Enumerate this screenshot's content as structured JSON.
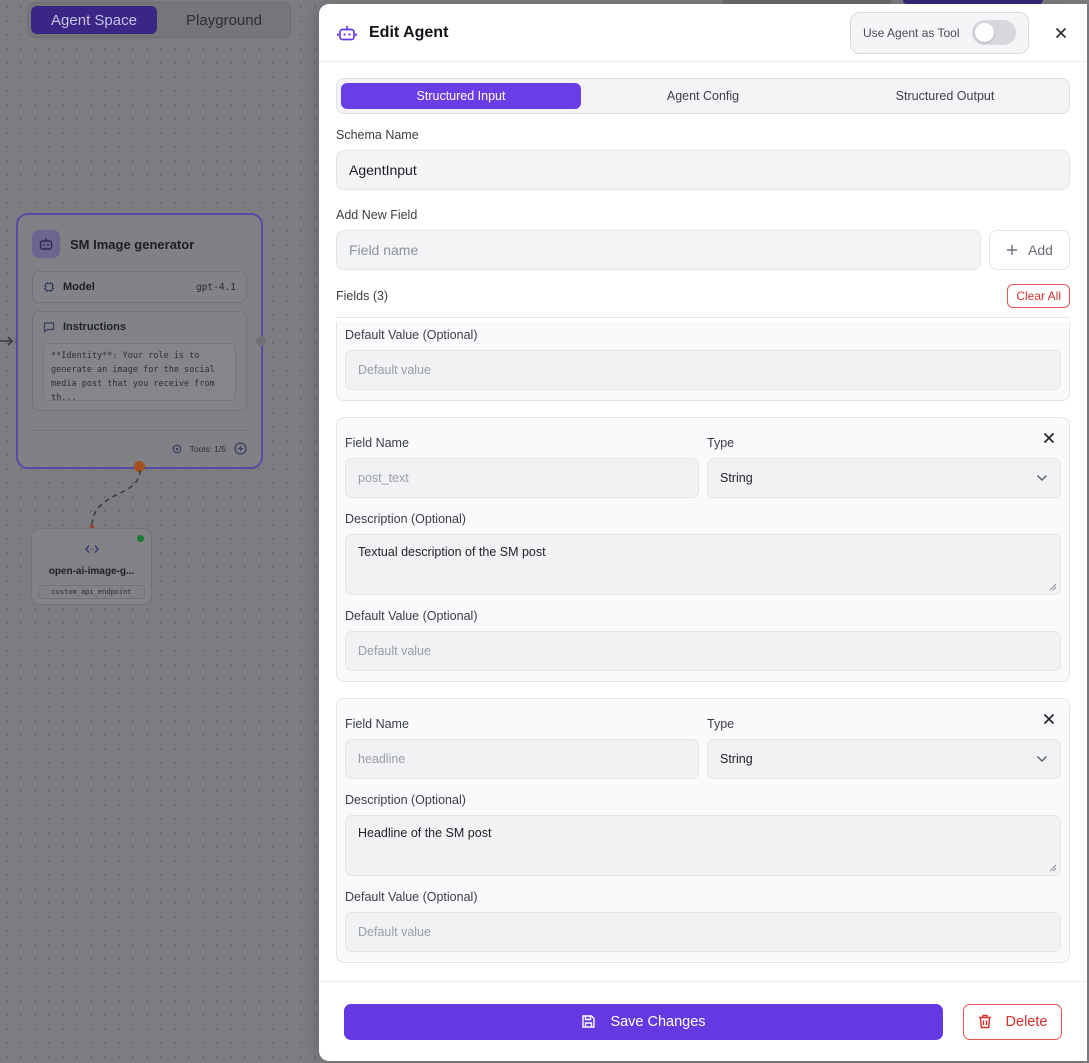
{
  "canvas": {
    "tabs": [
      "Agent Space",
      "Playground"
    ],
    "agent_node": {
      "title": "SM Image generator",
      "model_label": "Model",
      "model_value": "gpt-4.1",
      "instructions_label": "Instructions",
      "instructions_text": "**Identity**: Your role is to generate an image for the social media post that you receive from th...",
      "tools_label": "Tools: 1/5"
    },
    "tool_node": {
      "name": "open-ai-image-g...",
      "tag": "custom_api_endpoint"
    }
  },
  "panel": {
    "title": "Edit Agent",
    "toggle_label": "Use Agent as Tool",
    "toggle_on": false,
    "tabs": [
      "Structured Input",
      "Agent Config",
      "Structured Output"
    ],
    "active_tab": "Structured Input",
    "schema_name_label": "Schema Name",
    "schema_name_value": "AgentInput",
    "add_field_label": "Add New Field",
    "field_name_placeholder": "Field name",
    "add_button": "Add",
    "fields_label": "Fields (3)",
    "clear_all": "Clear All",
    "field_name_label": "Field Name",
    "type_label": "Type",
    "description_label": "Description (Optional)",
    "default_label": "Default Value (Optional)",
    "default_placeholder": "Default value",
    "fields": [
      {
        "name": "post_text",
        "type": "String",
        "description": "Textual description of the SM post"
      },
      {
        "name": "headline",
        "type": "String",
        "description": "Headline of the SM post"
      }
    ],
    "save_button": "Save Changes",
    "delete_button": "Delete"
  },
  "colors": {
    "accent": "#6539e2",
    "danger": "#d4302c"
  }
}
